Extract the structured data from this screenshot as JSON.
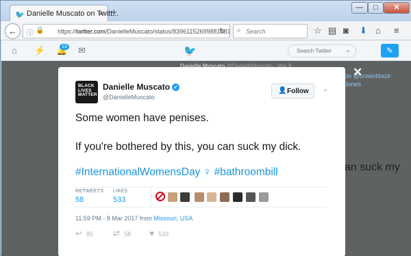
{
  "browser": {
    "tab_title": "Danielle Muscato on Twitt...",
    "tab_close": "×",
    "new_tab": "+",
    "url_prefix": "https://",
    "url_domain": "twitter.com",
    "url_path": "/DanielleMuscato/status/839611526998818817",
    "search_placeholder": "Search",
    "window_min": "—",
    "window_max": "□",
    "window_close": "✕"
  },
  "twitter_nav": {
    "notif_count": "13",
    "search_placeholder": "Search Twitter"
  },
  "background": {
    "name": "Danielle Muscato",
    "handle_date": "@DanielleMuscato · Mar 9",
    "reply_to": "on @crownblaze",
    "reply_to2": "Jones",
    "text_fragment": "an suck my"
  },
  "tweet": {
    "avatar_text": "BLACK LIVES MATTER",
    "display_name": "Danielle Muscato",
    "handle": "@DanielleMuscato",
    "follow_label": "Follow",
    "line1": "Some women have penises.",
    "line2": "If you're bothered by this, you can suck my dick.",
    "hashtag1": "#InternationalWomensDay",
    "emoji": "♀",
    "hashtag2": "#bathroombill",
    "retweets_label": "RETWEETS",
    "retweets_value": "58",
    "likes_label": "LIKES",
    "likes_value": "533",
    "timestamp": "11:59 PM - 8 Mar 2017 from",
    "location": "Missouri, USA",
    "reply_count": "85",
    "retweet_count": "58",
    "like_count": "533"
  },
  "colors": {
    "twitter_blue": "#1da1f2",
    "link_blue": "#1b95e0",
    "overlay": "#5f6263"
  }
}
